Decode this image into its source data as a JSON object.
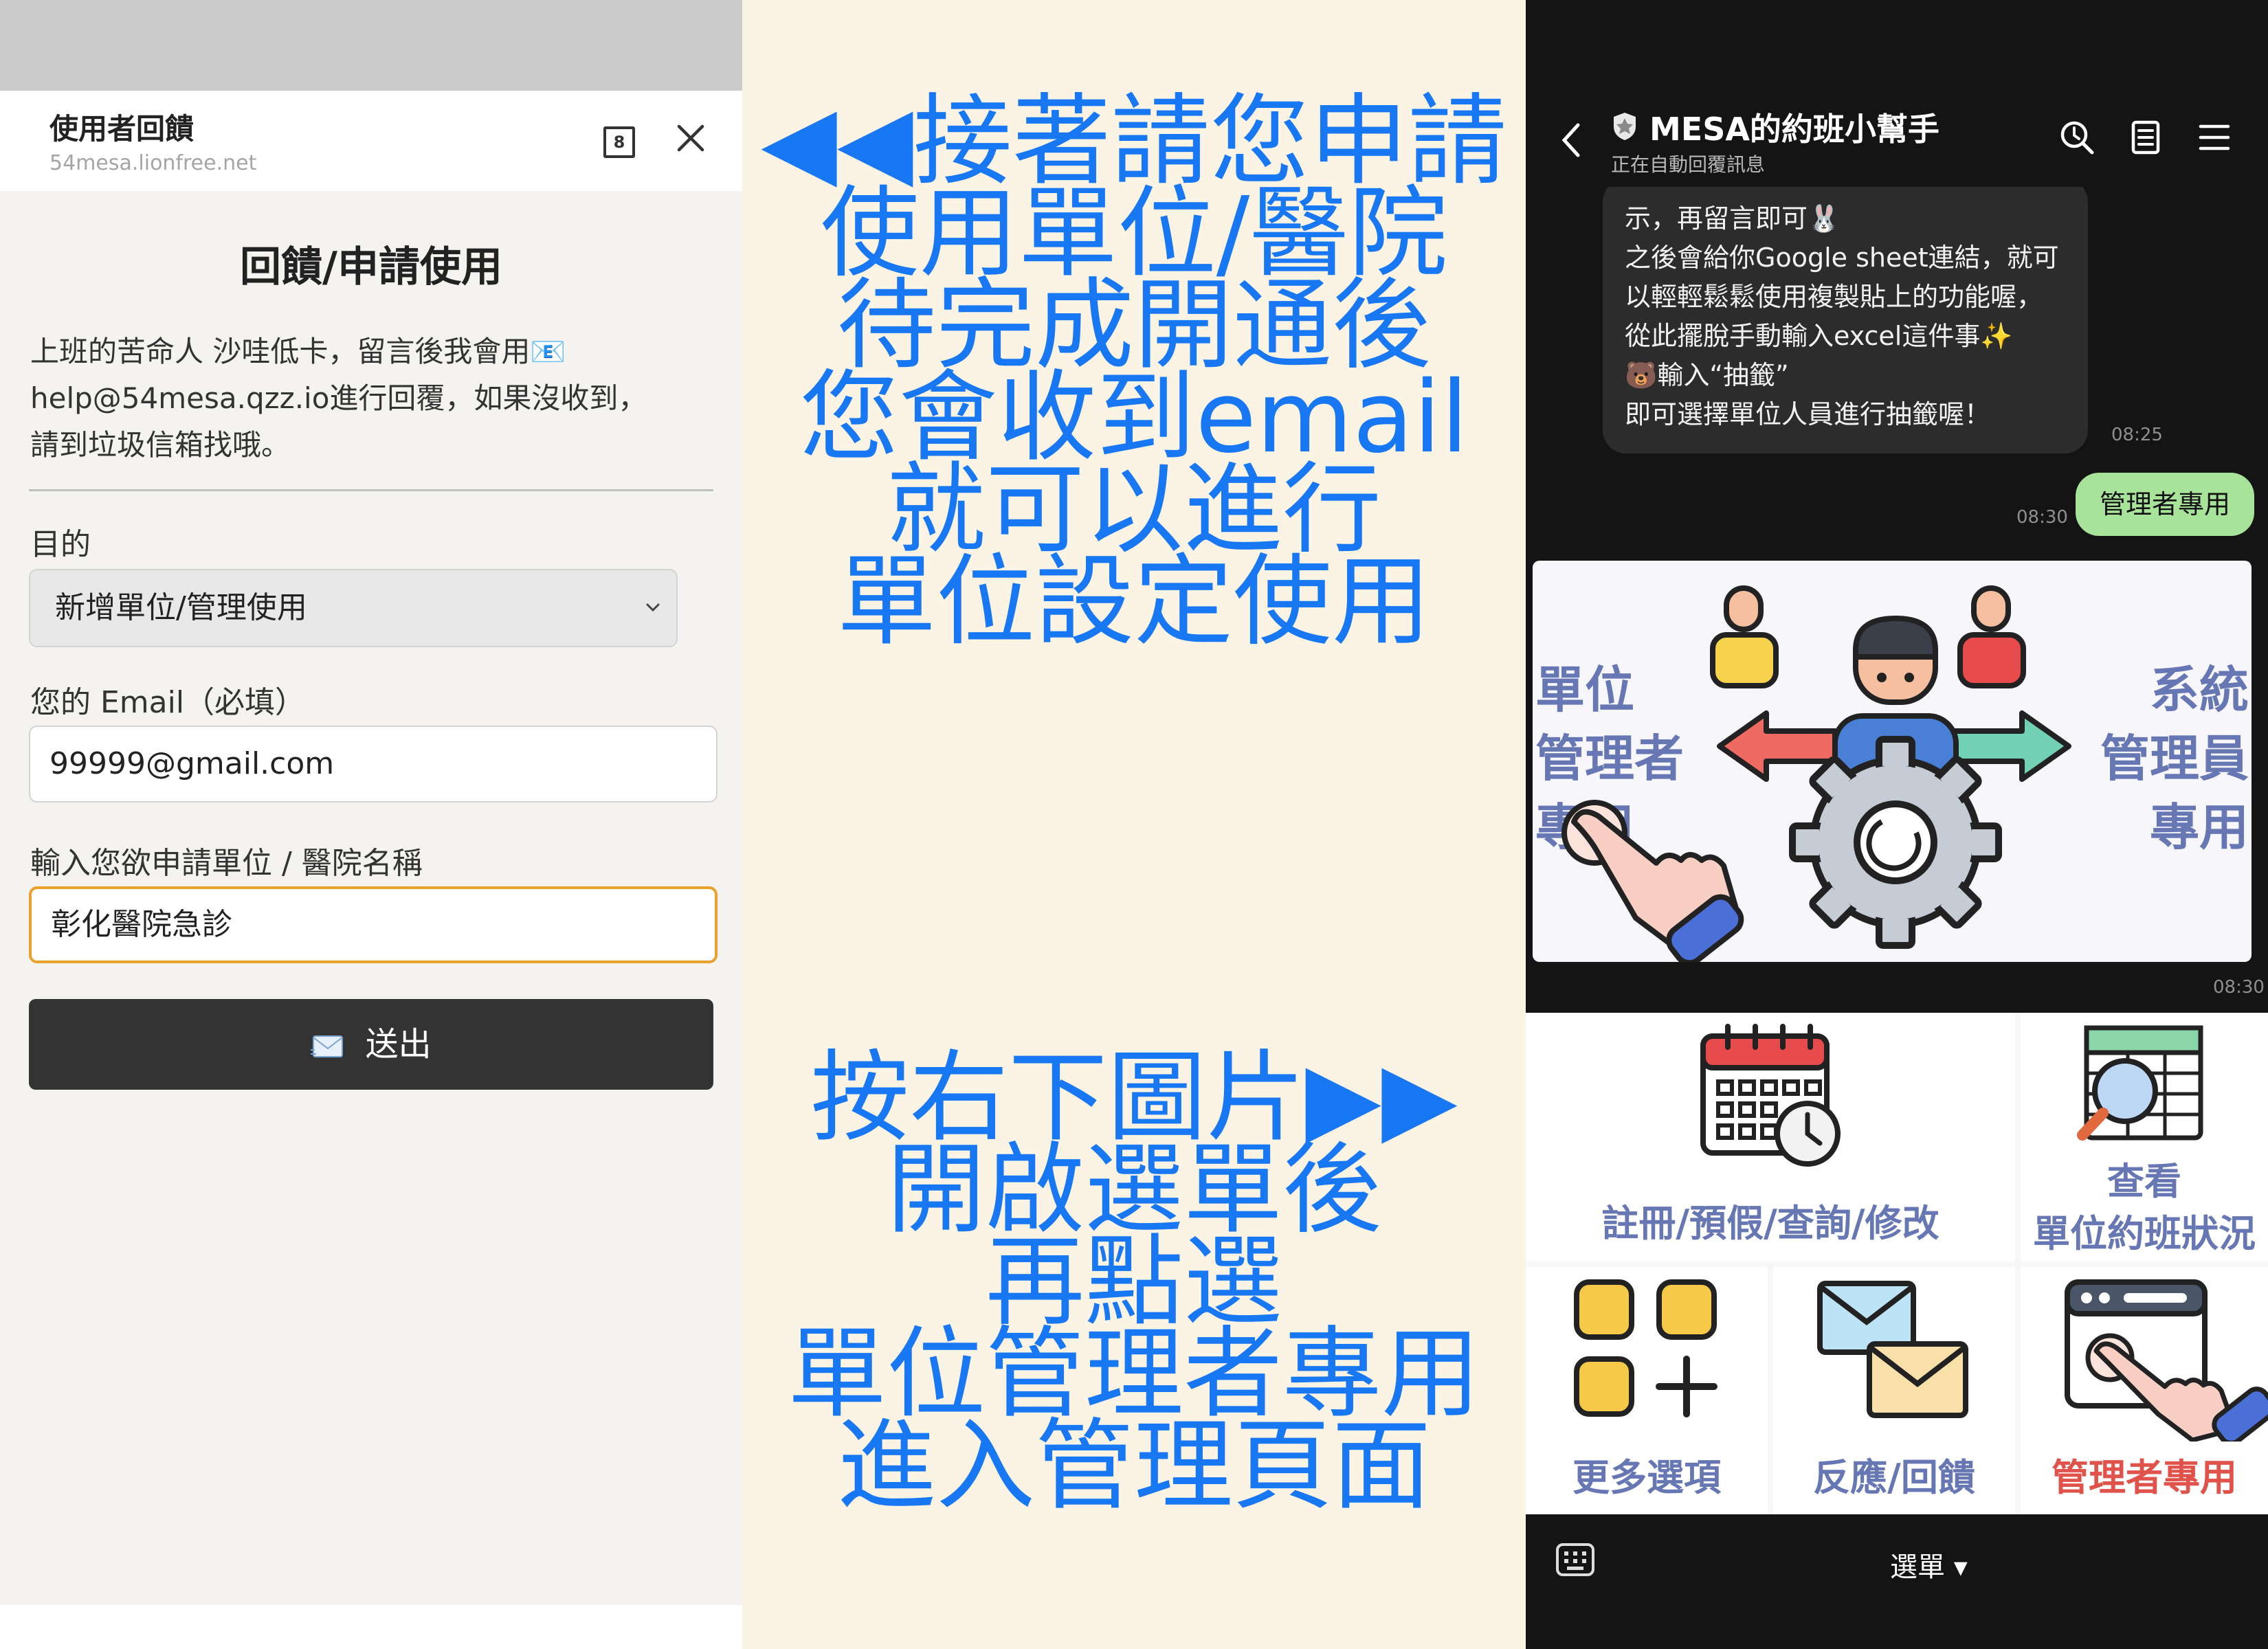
{
  "left": {
    "header": {
      "title": "使用者回饋",
      "url": "54mesa.lionfree.net",
      "tab_count": "8"
    },
    "form_title": "回饋/申請使用",
    "intro_lines": [
      "上班的苦命人 沙哇低卡，留言後我會用📧",
      "help@54mesa.qzz.io進行回覆，如果沒收到，",
      "請到垃圾信箱找哦。"
    ],
    "purpose": {
      "label": "目的",
      "value": "新增單位/管理使用"
    },
    "email": {
      "label": "您的 Email（必填）",
      "value": "99999@gmail.com"
    },
    "unit": {
      "label": "輸入您欲申請單位 / 醫院名稱",
      "value": "彰化醫院急診"
    },
    "submit_label": "送出"
  },
  "instructions": {
    "top": [
      "◀◀接著請您申請",
      "使用單位/醫院",
      "待完成開通後",
      "您會收到email",
      "就可以進行",
      "單位設定使用"
    ],
    "bottom": [
      "按右下圖片▶▶",
      "開啟選單後",
      "再點選",
      "單位管理者專用",
      "進入管理頁面"
    ],
    "text_color": "#1877f2"
  },
  "chat": {
    "name": "MESA的約班小幫手",
    "status": "正在自動回覆訊息",
    "message_lines": [
      "示，再留言即可🐰",
      "之後會給你Google sheet連結，就可",
      "以輕輕鬆鬆使用複製貼上的功能喔，",
      "從此擺脫手動輸入excel這件事✨",
      "🐻輸入“抽籤”",
      "即可選擇單位人員進行抽籤喔！"
    ],
    "message_time": "08:25",
    "sent_text": "管理者專用",
    "sent_time": "08:30",
    "image_time": "08:30",
    "image_card": {
      "left_lines": [
        "單位",
        "管理者",
        "專用"
      ],
      "right_lines": [
        "系統",
        "管理員",
        "專用"
      ]
    },
    "rich_menu": [
      {
        "label": "註冊/預假/查詢/修改",
        "icon": "calendar-clock-icon"
      },
      {
        "label_lines": [
          "查看",
          "單位約班狀況"
        ],
        "icon": "spreadsheet-magnifier-icon"
      },
      {
        "label": "更多選項",
        "icon": "more-options-icon"
      },
      {
        "label": "反應/回饋",
        "icon": "envelopes-icon"
      },
      {
        "label": "管理者專用",
        "icon": "admin-hand-click-icon"
      }
    ],
    "footer_menu_label": "選單 ▾",
    "colors": {
      "sent_bubble": "#a8e39a",
      "menu_label": "#6677b4",
      "admin_label": "#e0534a"
    }
  }
}
